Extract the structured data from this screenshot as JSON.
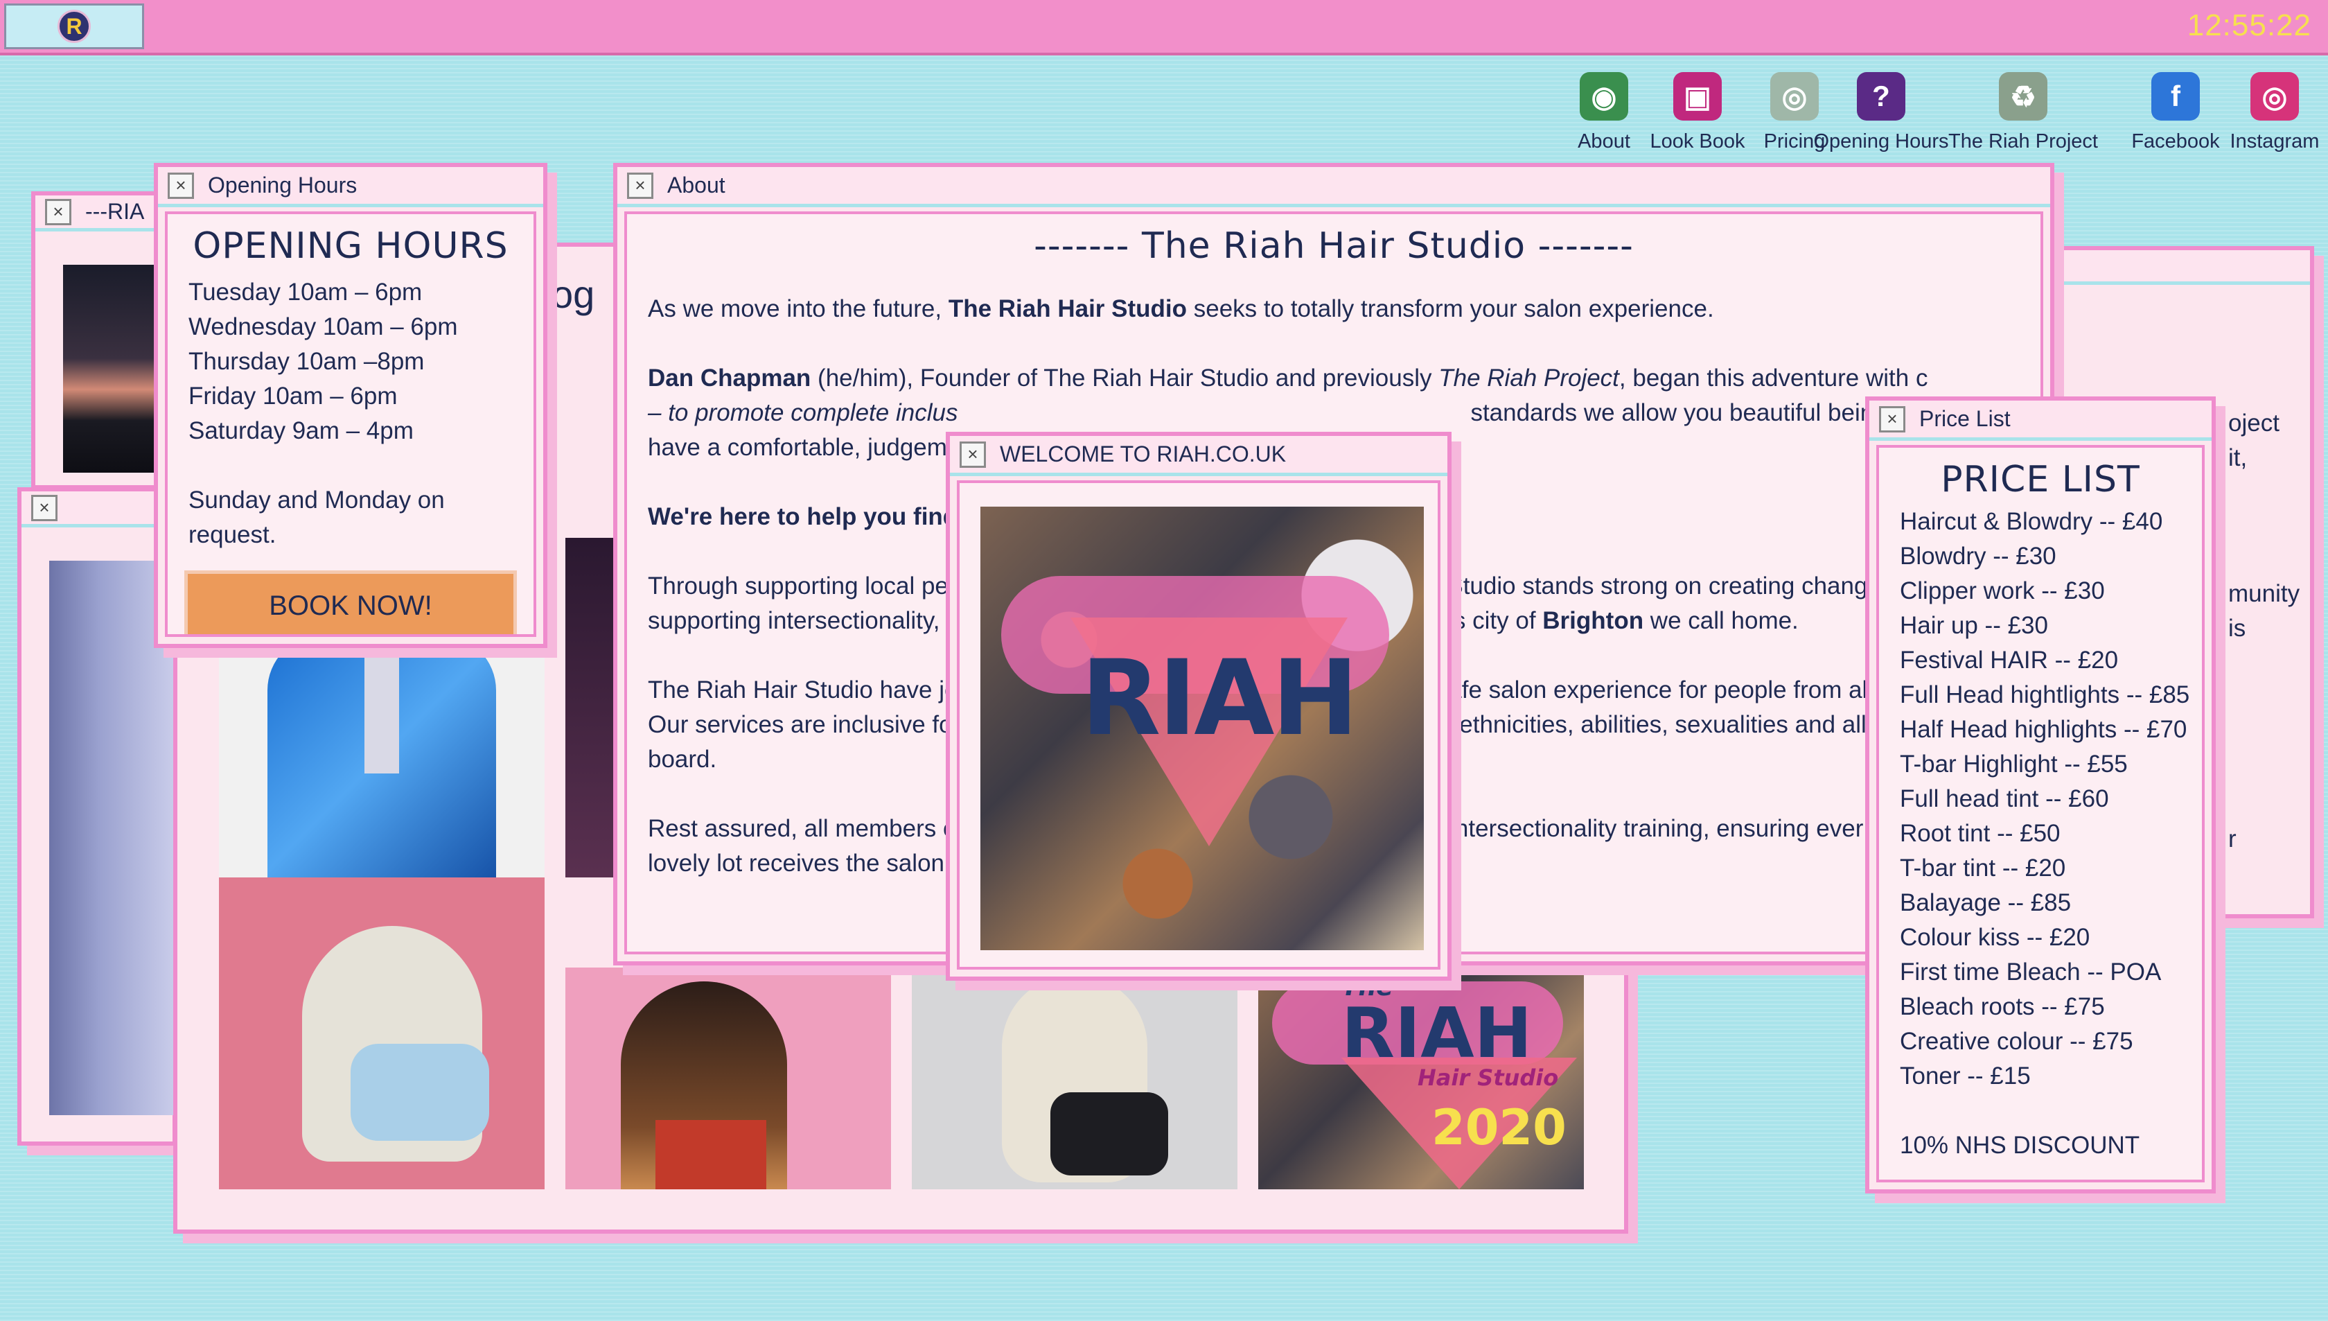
{
  "taskbar": {
    "clock": "12:55:22",
    "start_logo": "R"
  },
  "desktop_icons": [
    {
      "label": "About",
      "icon": "globe-icon",
      "color": "#3a8f4e",
      "glyph": "◉"
    },
    {
      "label": "Look Book",
      "icon": "cube-icon",
      "color": "#c0287e",
      "glyph": "▣"
    },
    {
      "label": "Pricing",
      "icon": "disc-icon",
      "color": "#9fb7a8",
      "glyph": "◎"
    },
    {
      "label": "Opening Hours",
      "icon": "book-icon",
      "color": "#5a2a86",
      "glyph": "?"
    },
    {
      "label": "The Riah Project",
      "icon": "recycle-bin-icon",
      "color": "#8aa08c",
      "glyph": "♻"
    },
    {
      "label": "Facebook",
      "icon": "facebook-icon",
      "color": "#2d76d9",
      "glyph": "f"
    },
    {
      "label": "Instagram",
      "icon": "instagram-icon",
      "color": "#d6337a",
      "glyph": "◎"
    }
  ],
  "windows": {
    "riah_back": {
      "title": "---RIA"
    },
    "lookbook": {
      "title": "",
      "partial_heading": "og"
    },
    "opening_hours": {
      "title": "Opening Hours",
      "heading": "OPENING HOURS",
      "lines": [
        "Tuesday 10am – 6pm",
        "Wednesday 10am – 6pm",
        "Thursday 10am –8pm",
        "Friday 10am – 6pm",
        "Saturday 9am – 4pm"
      ],
      "note": "Sunday and Monday on request.",
      "book_button": "BOOK NOW!"
    },
    "about": {
      "title": "About",
      "heading": "------- The Riah Hair Studio -------",
      "p1_a": "As we move into the future, ",
      "p1_b": "The Riah Hair Studio",
      "p1_c": " seeks to totally transform your salon experience.",
      "p2_a": "Dan Chapman",
      "p2_b": " (he/him), Founder of The Riah Hair Studio and previously ",
      "p2_c": "The Riah Project",
      "p2_d": ", began this adventure with c",
      "p2_line2a": "– to promote complete inclus",
      "p2_line2b": "standards we allow you beautiful beings",
      "p2_line3": "have a comfortable, judgeme",
      "p3": "We're here to help you find",
      "p4_l1a": "Through supporting local peo",
      "p4_l1b": "Studio stands strong on creating chang",
      "p4_l2a": "supporting intersectionality, r",
      "p4_l2b": "s city of ",
      "p4_l2c": "Brighton",
      "p4_l2d": " we call home.",
      "p5_l1a": "The Riah Hair Studio have joi",
      "p5_l1b": "afe salon experience for people from all",
      "p5_l2a": "Our services are inclusive for",
      "p5_l2b": "ethnicities, abilities, sexualities and allie",
      "p5_l3": "board.",
      "p6_l1a": "Rest assured, all members of",
      "p6_l1b": "Intersectionality training, ensuring ever",
      "p6_l2": "lovely lot receives the salon e"
    },
    "welcome": {
      "title": "WELCOME TO RIAH.CO.UK",
      "logo_text": "RIAH"
    },
    "price_list": {
      "title": "Price List",
      "heading": "PRICE LIST",
      "items": [
        "Haircut & Blowdry -- £40",
        "Blowdry -- £30",
        "Clipper work -- £30",
        "Hair up -- £30",
        "Festival HAIR -- £20",
        "Full Head hightlights -- £85",
        "Half Head highlights -- £70",
        "T-bar Highlight -- £55",
        "Full head tint -- £60",
        "Root tint -- £50",
        "T-bar tint -- £20",
        "Balayage -- £85",
        "Colour kiss -- £20",
        "First time Bleach -- POA",
        "Bleach roots -- £75",
        "Creative colour -- £75",
        "Toner -- £15"
      ],
      "discount": "10% NHS DISCOUNT"
    },
    "project_back": {
      "fragments": [
        "oject",
        "it,",
        "munity",
        "is",
        "r"
      ]
    },
    "lookbook_tile": {
      "line1": "The",
      "line2": "RIAH",
      "line3": "Hair Studio",
      "line4": "2020"
    }
  },
  "colors": {
    "desktop": "#a9e3ea",
    "taskbar": "#f28fca",
    "window_border": "#ef8ccd",
    "button": "#ec9a5a",
    "text": "#1f2a52",
    "clock": "#f7e04e"
  }
}
